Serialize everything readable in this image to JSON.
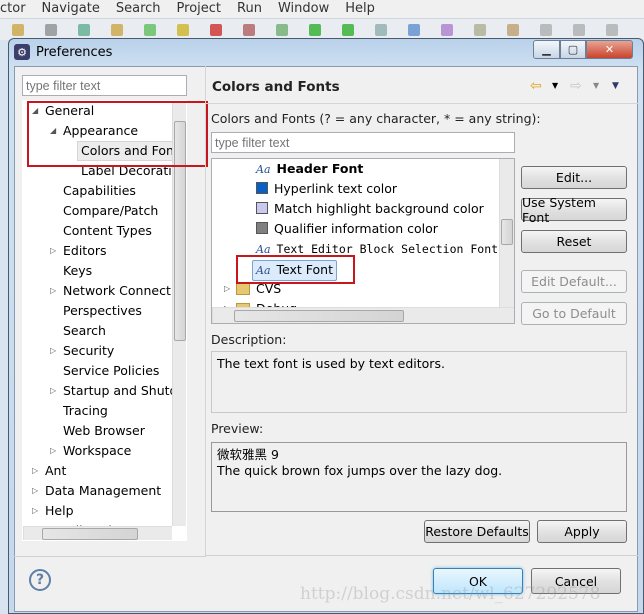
{
  "menubar": [
    "ctor",
    "Navigate",
    "Search",
    "Project",
    "Run",
    "Window",
    "Help"
  ],
  "window": {
    "title": "Preferences",
    "icon": "preferences-gear-icon",
    "controls": [
      "minimize",
      "maximize",
      "close"
    ]
  },
  "left": {
    "filter_placeholder": "type filter text",
    "tree": [
      {
        "label": "General",
        "level": 0,
        "state": "expanded"
      },
      {
        "label": "Appearance",
        "level": 1,
        "state": "expanded"
      },
      {
        "label": "Colors and Fonts",
        "level": 2,
        "state": "leaf",
        "selected": true
      },
      {
        "label": "Label Decorations",
        "level": 2,
        "state": "leaf"
      },
      {
        "label": "Capabilities",
        "level": 1,
        "state": "leaf"
      },
      {
        "label": "Compare/Patch",
        "level": 1,
        "state": "leaf"
      },
      {
        "label": "Content Types",
        "level": 1,
        "state": "leaf"
      },
      {
        "label": "Editors",
        "level": 1,
        "state": "collapsed"
      },
      {
        "label": "Keys",
        "level": 1,
        "state": "leaf"
      },
      {
        "label": "Network Connections",
        "level": 1,
        "state": "collapsed"
      },
      {
        "label": "Perspectives",
        "level": 1,
        "state": "leaf"
      },
      {
        "label": "Search",
        "level": 1,
        "state": "leaf"
      },
      {
        "label": "Security",
        "level": 1,
        "state": "collapsed"
      },
      {
        "label": "Service Policies",
        "level": 1,
        "state": "leaf"
      },
      {
        "label": "Startup and Shutdown",
        "level": 1,
        "state": "collapsed"
      },
      {
        "label": "Tracing",
        "level": 1,
        "state": "leaf"
      },
      {
        "label": "Web Browser",
        "level": 1,
        "state": "leaf"
      },
      {
        "label": "Workspace",
        "level": 1,
        "state": "collapsed"
      },
      {
        "label": "Ant",
        "level": 0,
        "state": "collapsed"
      },
      {
        "label": "Data Management",
        "level": 0,
        "state": "collapsed"
      },
      {
        "label": "Help",
        "level": 0,
        "state": "collapsed"
      },
      {
        "label": "Install/Update",
        "level": 0,
        "state": "collapsed"
      }
    ]
  },
  "right": {
    "title": "Colors and Fonts",
    "filter_label": "Colors and Fonts (? = any character, * = any string):",
    "filter_placeholder": "type filter text",
    "items": [
      {
        "label": "Header Font",
        "kind": "font",
        "bold": true
      },
      {
        "label": "Hyperlink text color",
        "kind": "color",
        "color": "#0a5fc4"
      },
      {
        "label": "Match highlight background color",
        "kind": "color",
        "color": "#c8c8f0"
      },
      {
        "label": "Qualifier information color",
        "kind": "color",
        "color": "#808080"
      },
      {
        "label": "Text Editor Block Selection Font",
        "kind": "font",
        "mono": true
      },
      {
        "label": "Text Font",
        "kind": "font",
        "selected": true
      },
      {
        "label": "CVS",
        "kind": "category"
      },
      {
        "label": "Debug",
        "kind": "category"
      }
    ],
    "buttons": {
      "edit": "Edit...",
      "use_system_font": "Use System Font",
      "reset": "Reset",
      "edit_default": "Edit Default...",
      "go_to_default": "Go to Default"
    },
    "description_label": "Description:",
    "description": "The text font is used by text editors.",
    "preview_label": "Preview:",
    "preview_font": "微软雅黑 9",
    "preview_text": "The quick brown fox jumps over the lazy dog.",
    "restore_defaults": "Restore Defaults",
    "apply": "Apply"
  },
  "footer": {
    "ok": "OK",
    "cancel": "Cancel"
  },
  "watermark": "http://blog.csdn.net/wl_627292578"
}
